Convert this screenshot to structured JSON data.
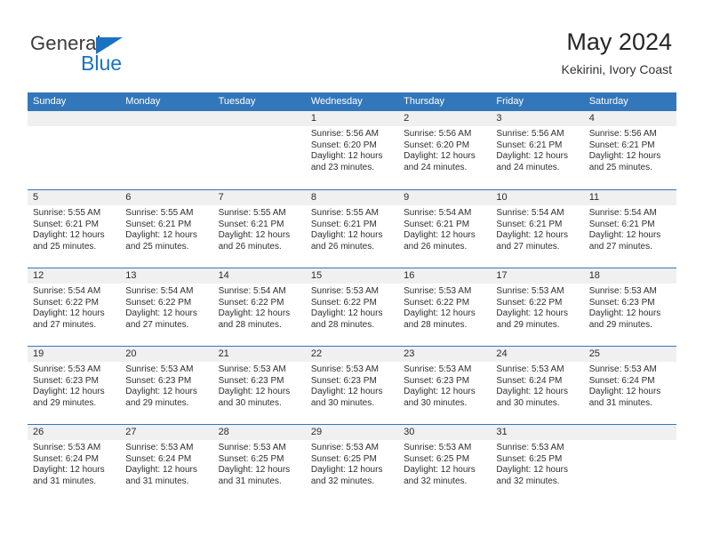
{
  "brand": {
    "name_top": "General",
    "name_bottom": "Blue",
    "accent_color": "#1b72c0"
  },
  "header": {
    "title": "May 2024",
    "location": "Kekirini, Ivory Coast"
  },
  "calendar": {
    "header_color": "#3377bb",
    "day_band_color": "#f0f0f0",
    "day_names": [
      "Sunday",
      "Monday",
      "Tuesday",
      "Wednesday",
      "Thursday",
      "Friday",
      "Saturday"
    ],
    "weeks": [
      [
        {
          "day": "",
          "lines": []
        },
        {
          "day": "",
          "lines": []
        },
        {
          "day": "",
          "lines": []
        },
        {
          "day": "1",
          "lines": [
            "Sunrise: 5:56 AM",
            "Sunset: 6:20 PM",
            "Daylight: 12 hours",
            "and 23 minutes."
          ]
        },
        {
          "day": "2",
          "lines": [
            "Sunrise: 5:56 AM",
            "Sunset: 6:20 PM",
            "Daylight: 12 hours",
            "and 24 minutes."
          ]
        },
        {
          "day": "3",
          "lines": [
            "Sunrise: 5:56 AM",
            "Sunset: 6:21 PM",
            "Daylight: 12 hours",
            "and 24 minutes."
          ]
        },
        {
          "day": "4",
          "lines": [
            "Sunrise: 5:56 AM",
            "Sunset: 6:21 PM",
            "Daylight: 12 hours",
            "and 25 minutes."
          ]
        }
      ],
      [
        {
          "day": "5",
          "lines": [
            "Sunrise: 5:55 AM",
            "Sunset: 6:21 PM",
            "Daylight: 12 hours",
            "and 25 minutes."
          ]
        },
        {
          "day": "6",
          "lines": [
            "Sunrise: 5:55 AM",
            "Sunset: 6:21 PM",
            "Daylight: 12 hours",
            "and 25 minutes."
          ]
        },
        {
          "day": "7",
          "lines": [
            "Sunrise: 5:55 AM",
            "Sunset: 6:21 PM",
            "Daylight: 12 hours",
            "and 26 minutes."
          ]
        },
        {
          "day": "8",
          "lines": [
            "Sunrise: 5:55 AM",
            "Sunset: 6:21 PM",
            "Daylight: 12 hours",
            "and 26 minutes."
          ]
        },
        {
          "day": "9",
          "lines": [
            "Sunrise: 5:54 AM",
            "Sunset: 6:21 PM",
            "Daylight: 12 hours",
            "and 26 minutes."
          ]
        },
        {
          "day": "10",
          "lines": [
            "Sunrise: 5:54 AM",
            "Sunset: 6:21 PM",
            "Daylight: 12 hours",
            "and 27 minutes."
          ]
        },
        {
          "day": "11",
          "lines": [
            "Sunrise: 5:54 AM",
            "Sunset: 6:21 PM",
            "Daylight: 12 hours",
            "and 27 minutes."
          ]
        }
      ],
      [
        {
          "day": "12",
          "lines": [
            "Sunrise: 5:54 AM",
            "Sunset: 6:22 PM",
            "Daylight: 12 hours",
            "and 27 minutes."
          ]
        },
        {
          "day": "13",
          "lines": [
            "Sunrise: 5:54 AM",
            "Sunset: 6:22 PM",
            "Daylight: 12 hours",
            "and 27 minutes."
          ]
        },
        {
          "day": "14",
          "lines": [
            "Sunrise: 5:54 AM",
            "Sunset: 6:22 PM",
            "Daylight: 12 hours",
            "and 28 minutes."
          ]
        },
        {
          "day": "15",
          "lines": [
            "Sunrise: 5:53 AM",
            "Sunset: 6:22 PM",
            "Daylight: 12 hours",
            "and 28 minutes."
          ]
        },
        {
          "day": "16",
          "lines": [
            "Sunrise: 5:53 AM",
            "Sunset: 6:22 PM",
            "Daylight: 12 hours",
            "and 28 minutes."
          ]
        },
        {
          "day": "17",
          "lines": [
            "Sunrise: 5:53 AM",
            "Sunset: 6:22 PM",
            "Daylight: 12 hours",
            "and 29 minutes."
          ]
        },
        {
          "day": "18",
          "lines": [
            "Sunrise: 5:53 AM",
            "Sunset: 6:23 PM",
            "Daylight: 12 hours",
            "and 29 minutes."
          ]
        }
      ],
      [
        {
          "day": "19",
          "lines": [
            "Sunrise: 5:53 AM",
            "Sunset: 6:23 PM",
            "Daylight: 12 hours",
            "and 29 minutes."
          ]
        },
        {
          "day": "20",
          "lines": [
            "Sunrise: 5:53 AM",
            "Sunset: 6:23 PM",
            "Daylight: 12 hours",
            "and 29 minutes."
          ]
        },
        {
          "day": "21",
          "lines": [
            "Sunrise: 5:53 AM",
            "Sunset: 6:23 PM",
            "Daylight: 12 hours",
            "and 30 minutes."
          ]
        },
        {
          "day": "22",
          "lines": [
            "Sunrise: 5:53 AM",
            "Sunset: 6:23 PM",
            "Daylight: 12 hours",
            "and 30 minutes."
          ]
        },
        {
          "day": "23",
          "lines": [
            "Sunrise: 5:53 AM",
            "Sunset: 6:23 PM",
            "Daylight: 12 hours",
            "and 30 minutes."
          ]
        },
        {
          "day": "24",
          "lines": [
            "Sunrise: 5:53 AM",
            "Sunset: 6:24 PM",
            "Daylight: 12 hours",
            "and 30 minutes."
          ]
        },
        {
          "day": "25",
          "lines": [
            "Sunrise: 5:53 AM",
            "Sunset: 6:24 PM",
            "Daylight: 12 hours",
            "and 31 minutes."
          ]
        }
      ],
      [
        {
          "day": "26",
          "lines": [
            "Sunrise: 5:53 AM",
            "Sunset: 6:24 PM",
            "Daylight: 12 hours",
            "and 31 minutes."
          ]
        },
        {
          "day": "27",
          "lines": [
            "Sunrise: 5:53 AM",
            "Sunset: 6:24 PM",
            "Daylight: 12 hours",
            "and 31 minutes."
          ]
        },
        {
          "day": "28",
          "lines": [
            "Sunrise: 5:53 AM",
            "Sunset: 6:25 PM",
            "Daylight: 12 hours",
            "and 31 minutes."
          ]
        },
        {
          "day": "29",
          "lines": [
            "Sunrise: 5:53 AM",
            "Sunset: 6:25 PM",
            "Daylight: 12 hours",
            "and 32 minutes."
          ]
        },
        {
          "day": "30",
          "lines": [
            "Sunrise: 5:53 AM",
            "Sunset: 6:25 PM",
            "Daylight: 12 hours",
            "and 32 minutes."
          ]
        },
        {
          "day": "31",
          "lines": [
            "Sunrise: 5:53 AM",
            "Sunset: 6:25 PM",
            "Daylight: 12 hours",
            "and 32 minutes."
          ]
        },
        {
          "day": "",
          "lines": []
        }
      ]
    ]
  }
}
